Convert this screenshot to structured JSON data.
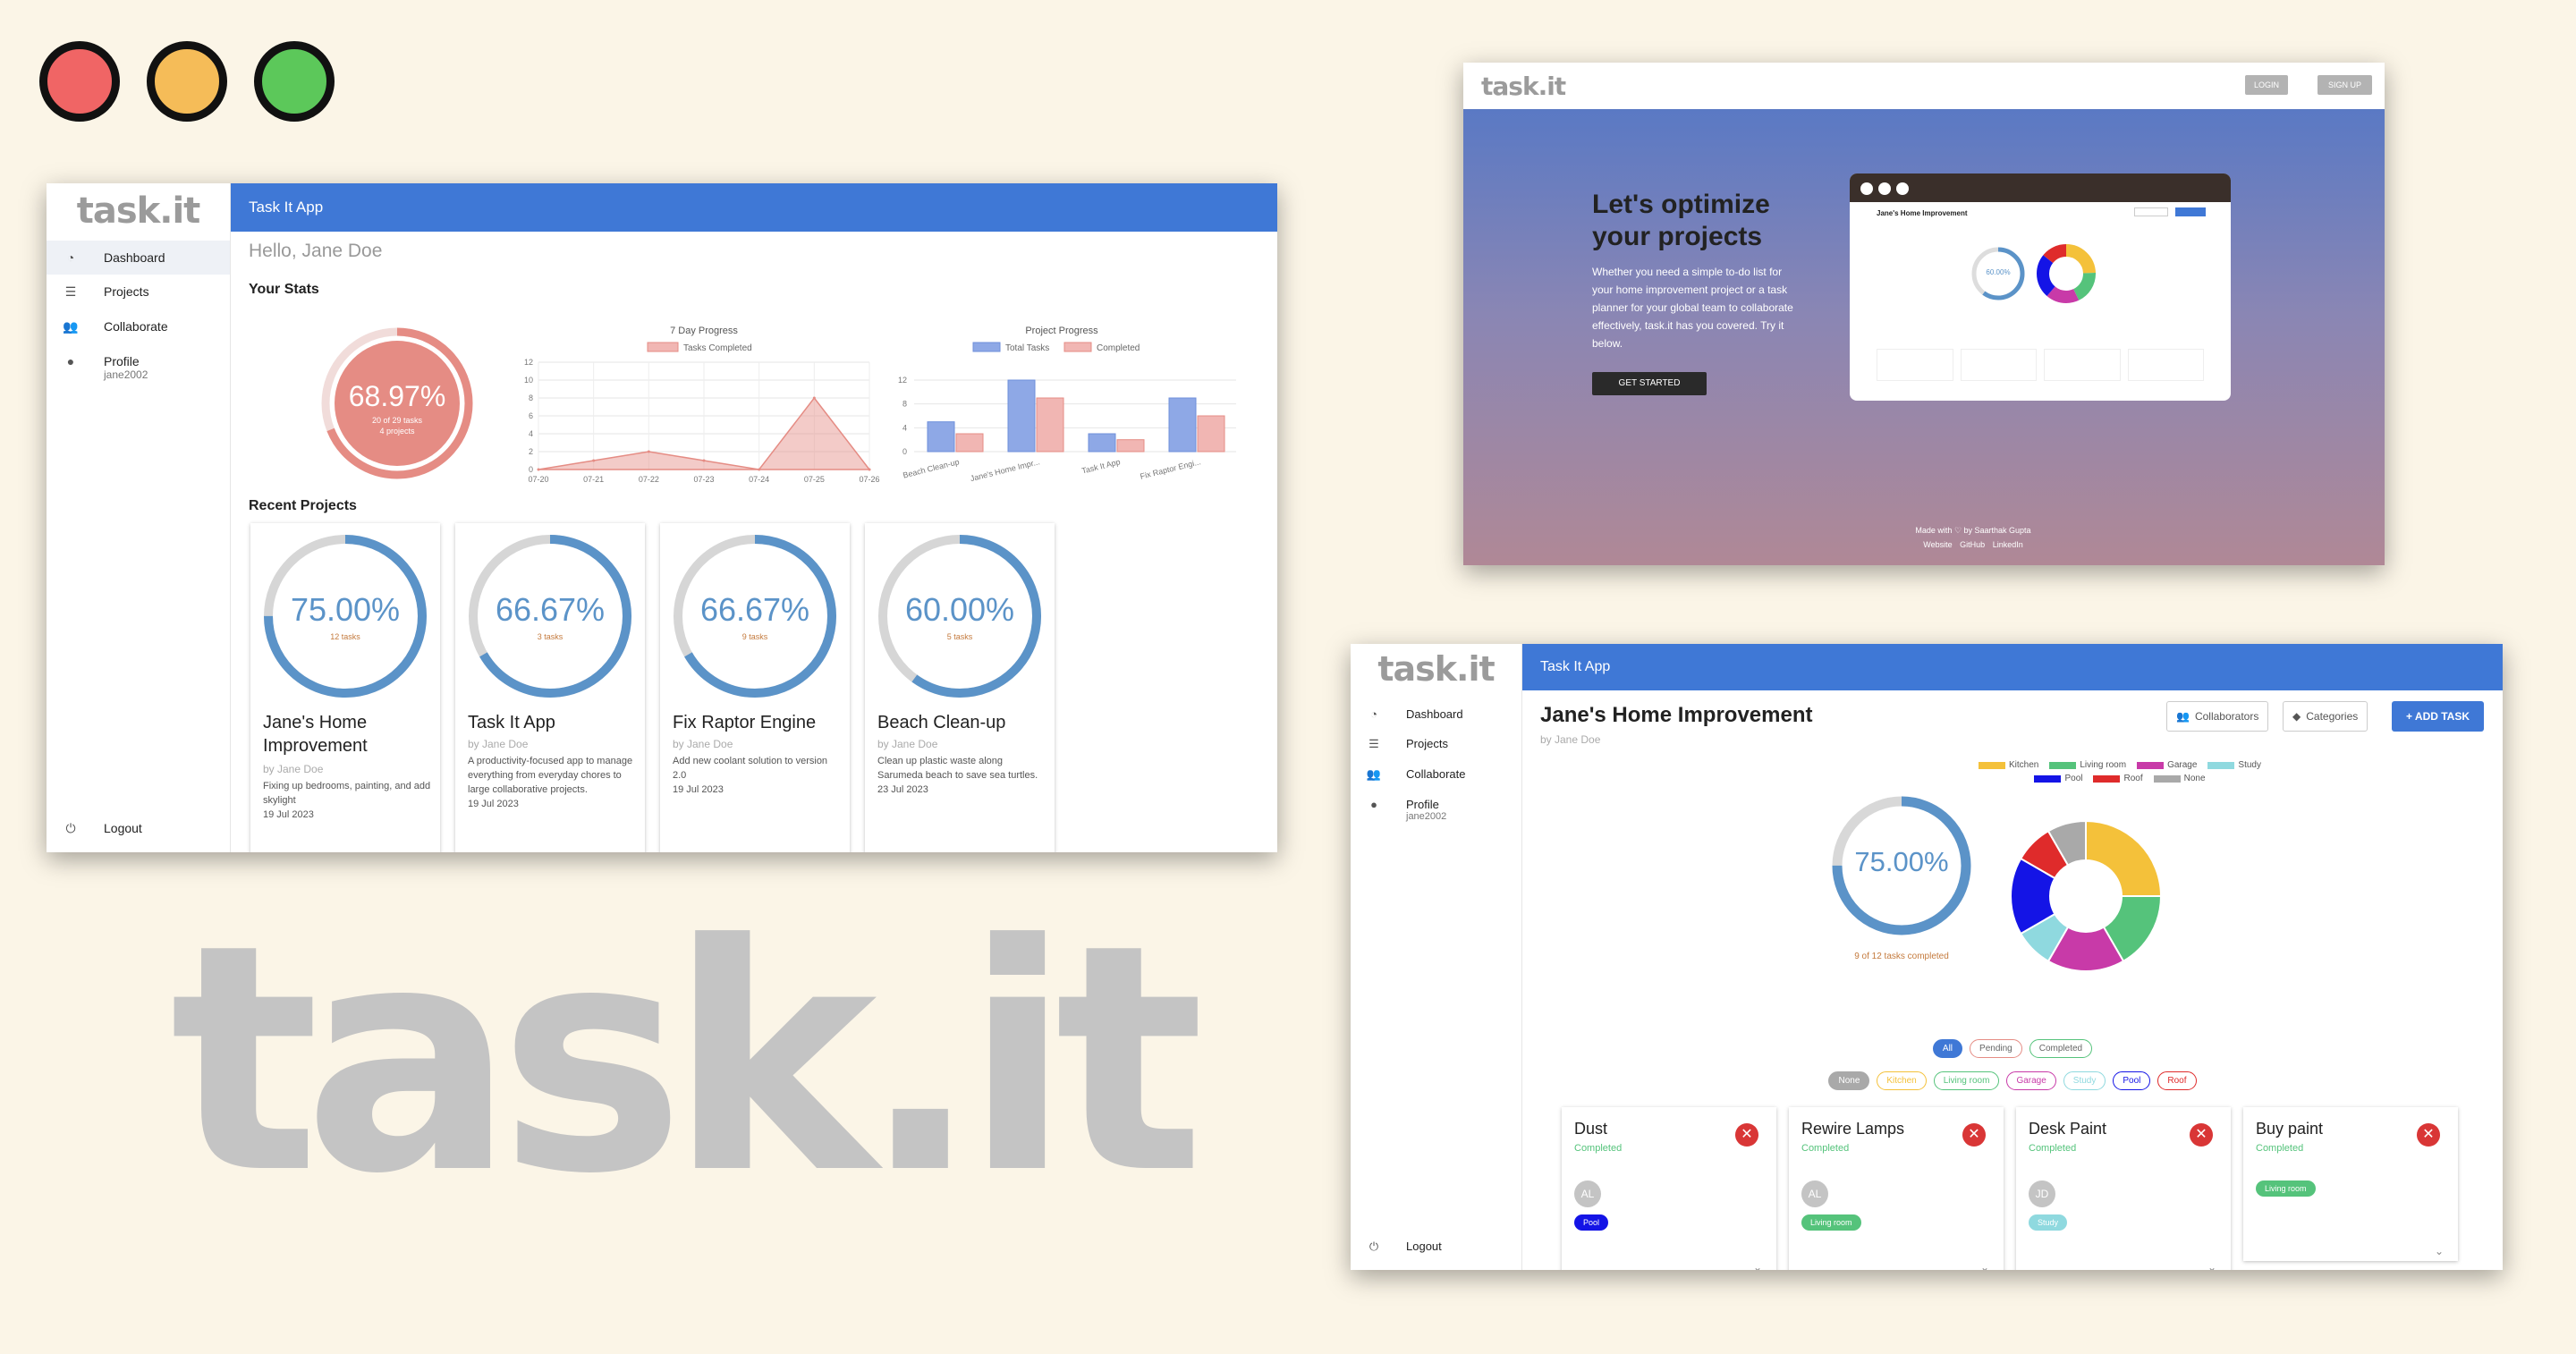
{
  "brand": "task.it",
  "colors": {
    "background": "#fbf5e7",
    "accent": "#3f78d6",
    "ring": "#5b93c8",
    "dashboard_ring": "#e58c84"
  },
  "dashboard": {
    "logo": "task.it",
    "app_title": "Task It App",
    "nav": [
      {
        "icon": "dashboard-icon",
        "label": "Dashboard"
      },
      {
        "icon": "list-icon",
        "label": "Projects"
      },
      {
        "icon": "people-icon",
        "label": "Collaborate"
      },
      {
        "icon": "person-icon",
        "label": "Profile",
        "sub": "jane2002"
      }
    ],
    "logout": "Logout",
    "greeting": "Hello, Jane Doe",
    "stats_heading": "Your Stats",
    "overall": {
      "percent_label": "68.97%",
      "percent": 68.97,
      "line1": "20 of 29 tasks",
      "line2": "4 projects"
    },
    "recent_heading": "Recent Projects",
    "projects": [
      {
        "percent_label": "75.00%",
        "percent": 75,
        "tasks": "12 tasks",
        "name": "Jane's Home Improvement",
        "author": "by Jane Doe",
        "desc": "Fixing up bedrooms, painting, and add skylight",
        "date": "19 Jul 2023"
      },
      {
        "percent_label": "66.67%",
        "percent": 66.67,
        "tasks": "3 tasks",
        "name": "Task It App",
        "author": "by Jane Doe",
        "desc": "A productivity-focused app to manage everything from everyday chores to large collaborative projects.",
        "date": "19 Jul 2023"
      },
      {
        "percent_label": "66.67%",
        "percent": 66.67,
        "tasks": "9 tasks",
        "name": "Fix Raptor Engine",
        "author": "by Jane Doe",
        "desc": "Add new coolant solution to version 2.0",
        "date": "19 Jul 2023"
      },
      {
        "percent_label": "60.00%",
        "percent": 60,
        "tasks": "5 tasks",
        "name": "Beach Clean-up",
        "author": "by Jane Doe",
        "desc": "Clean up plastic waste along Sarumeda beach to save sea turtles.",
        "date": "23 Jul 2023"
      }
    ]
  },
  "chart_data": [
    {
      "type": "area",
      "title": "7 Day Progress",
      "series": [
        {
          "name": "Tasks Completed",
          "values": [
            0,
            1,
            2,
            1,
            0,
            8,
            0
          ]
        }
      ],
      "x": [
        "07-20",
        "07-21",
        "07-22",
        "07-23",
        "07-24",
        "07-25",
        "07-26"
      ],
      "y_ticks": [
        "0",
        "2",
        "4",
        "6",
        "8",
        "10",
        "12"
      ],
      "ylim": [
        0,
        12
      ],
      "legend": "top",
      "grid": true
    },
    {
      "type": "bar",
      "title": "Project Progress",
      "categories": [
        "Beach Clean-up",
        "Jane's Home Impr...",
        "Task It App",
        "Fix Raptor Engi..."
      ],
      "series": [
        {
          "name": "Total Tasks",
          "values": [
            5,
            12,
            3,
            9
          ]
        },
        {
          "name": "Completed",
          "values": [
            3,
            9,
            2,
            6
          ]
        }
      ],
      "y_ticks": [
        "0",
        "4",
        "8",
        "12"
      ],
      "ylim": [
        0,
        12
      ],
      "legend": "top",
      "grid": true
    },
    {
      "type": "pie",
      "title": "",
      "categories": [
        "Kitchen",
        "Living room",
        "Garage",
        "Study",
        "Pool",
        "Roof",
        "None"
      ],
      "values": [
        3,
        2,
        2,
        1,
        2,
        1,
        1
      ],
      "colors": [
        "#f4c13a",
        "#55c37b",
        "#c83aa8",
        "#8fd9df",
        "#1414e6",
        "#df2b2b",
        "#a9a9a9"
      ],
      "legend": "top"
    }
  ],
  "landing": {
    "logo": "task.it",
    "login": "LOGIN",
    "signup": "SIGN UP",
    "headline1": "Let's optimize",
    "headline2": "your projects",
    "body": "Whether you need a simple to-do list for your home improvement project or a task planner for your global team to collaborate effectively, task.it has you covered. Try it below.",
    "cta": "GET STARTED",
    "preview_title": "Jane's Home Improvement",
    "preview_percent": "60.00%",
    "footer": "Made with ♡ by Saarthak Gupta",
    "links": [
      "Website",
      "GitHub",
      "LinkedIn"
    ]
  },
  "project": {
    "logo": "task.it",
    "app_title": "Task It App",
    "nav": [
      {
        "icon": "dashboard-icon",
        "label": "Dashboard"
      },
      {
        "icon": "list-icon",
        "label": "Projects"
      },
      {
        "icon": "people-icon",
        "label": "Collaborate"
      },
      {
        "icon": "person-icon",
        "label": "Profile",
        "sub": "jane2002"
      }
    ],
    "logout": "Logout",
    "title": "Jane's Home Improvement",
    "author": "by Jane Doe",
    "collaborators": "Collaborators",
    "categories_btn": "Categories",
    "add_task": "+ ADD TASK",
    "progress": {
      "percent_label": "75.00%",
      "percent": 75,
      "caption": "9 of 12 tasks completed"
    },
    "status_filters": [
      "All",
      "Pending",
      "Completed"
    ],
    "category_filters": [
      {
        "label": "None",
        "color": "#a9a9a9",
        "selected": true
      },
      {
        "label": "Kitchen",
        "color": "#f4c13a"
      },
      {
        "label": "Living room",
        "color": "#55c37b"
      },
      {
        "label": "Garage",
        "color": "#c83aa8"
      },
      {
        "label": "Study",
        "color": "#8fd9df"
      },
      {
        "label": "Pool",
        "color": "#1414e6"
      },
      {
        "label": "Roof",
        "color": "#df2b2b"
      }
    ],
    "tasks": [
      {
        "name": "Dust",
        "status": "Completed",
        "avatar": "AL",
        "tag": "Pool",
        "tag_color": "#1414e6"
      },
      {
        "name": "Rewire Lamps",
        "status": "Completed",
        "avatar": "AL",
        "tag": "Living room",
        "tag_color": "#55c37b"
      },
      {
        "name": "Desk Paint",
        "status": "Completed",
        "avatar": "JD",
        "tag": "Study",
        "tag_color": "#8fd9df"
      },
      {
        "name": "Buy paint",
        "status": "Completed",
        "avatar": "",
        "tag": "Living room",
        "tag_color": "#55c37b"
      }
    ]
  }
}
